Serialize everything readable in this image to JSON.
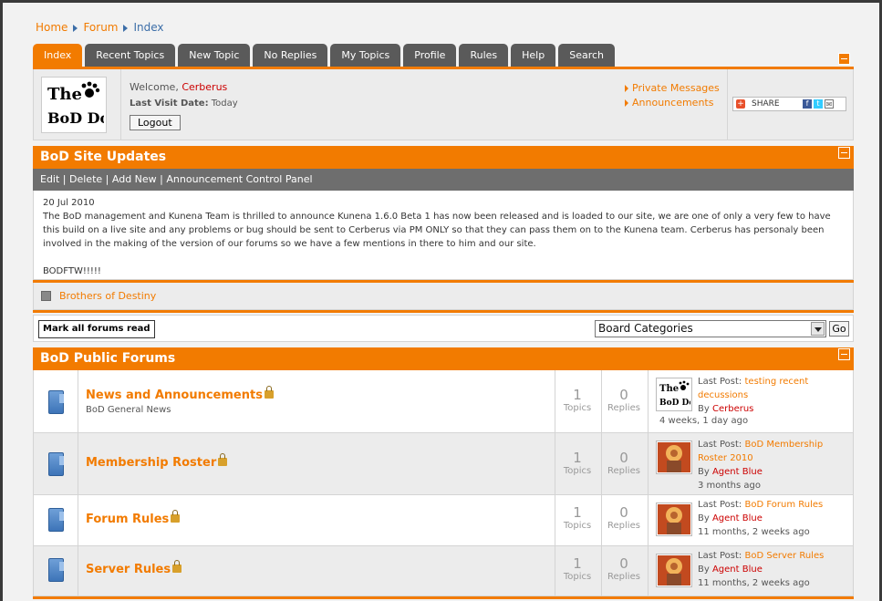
{
  "breadcrumb": [
    {
      "label": "Home"
    },
    {
      "label": "Forum"
    },
    {
      "label": "Index"
    }
  ],
  "tabs": [
    {
      "label": "Index",
      "active": true
    },
    {
      "label": "Recent Topics"
    },
    {
      "label": "New Topic"
    },
    {
      "label": "No Replies"
    },
    {
      "label": "My Topics"
    },
    {
      "label": "Profile"
    },
    {
      "label": "Rules"
    },
    {
      "label": "Help"
    },
    {
      "label": "Search"
    }
  ],
  "profile": {
    "welcome": "Welcome,",
    "username": "Cerberus",
    "last_visit_label": "Last Visit Date:",
    "last_visit_value": "Today",
    "logout_label": "Logout",
    "links": [
      "Private Messages",
      "Announcements"
    ],
    "share_label": "SHARE"
  },
  "logo": {
    "line1": "The",
    "line2": "BoD Dog"
  },
  "updates": {
    "title": "BoD Site Updates",
    "actions": [
      "Edit",
      "Delete",
      "Add New",
      "Announcement Control Panel"
    ],
    "date": "20 Jul 2010",
    "body": "The BoD management and Kunena Team is thrilled to announce Kunena 1.6.0 Beta 1 has now been released and is loaded to our site, we are one of only a very few to have this build on a live site and any problems or bug should be sent to Cerberus via PM ONLY so that they can pass them on to the Kunena team. Cerberus has personaly been involved in the making of the version of our forums so we have a few mentions in there to him and our site.",
    "footer": "BODFTW!!!!!"
  },
  "category_link": "Brothers of Destiny",
  "toolbar": {
    "mark_read": "Mark all forums read",
    "select_value": "Board Categories",
    "go": "Go"
  },
  "forums_section": {
    "title": "BoD Public Forums",
    "topics_label": "Topics",
    "replies_label": "Replies",
    "last_post_label": "Last Post:",
    "by_label": "By",
    "forums": [
      {
        "title": "News and Announcements",
        "desc": "BoD General News",
        "topics": "1",
        "replies": "0",
        "last_title": "testing recent decussions",
        "last_by": "Cerberus",
        "last_time": "4 weeks, 1 day ago",
        "avatar": "dog"
      },
      {
        "title": "Membership Roster",
        "desc": "",
        "topics": "1",
        "replies": "0",
        "last_title": "BoD Membership Roster 2010",
        "last_by": "Agent Blue",
        "last_time": "3 months ago",
        "avatar": "figure"
      },
      {
        "title": "Forum Rules",
        "desc": "",
        "topics": "1",
        "replies": "0",
        "last_title": "BoD Forum Rules",
        "last_by": "Agent Blue",
        "last_time": "11 months, 2 weeks ago",
        "avatar": "figure"
      },
      {
        "title": "Server Rules",
        "desc": "",
        "topics": "1",
        "replies": "0",
        "last_title": "BoD Server Rules",
        "last_by": "Agent Blue",
        "last_time": "11 months, 2 weeks ago",
        "avatar": "figure"
      }
    ]
  },
  "colors": {
    "accent": "#f27b00",
    "tab_inactive": "#5a5a5a",
    "user_link": "#cc0000"
  }
}
